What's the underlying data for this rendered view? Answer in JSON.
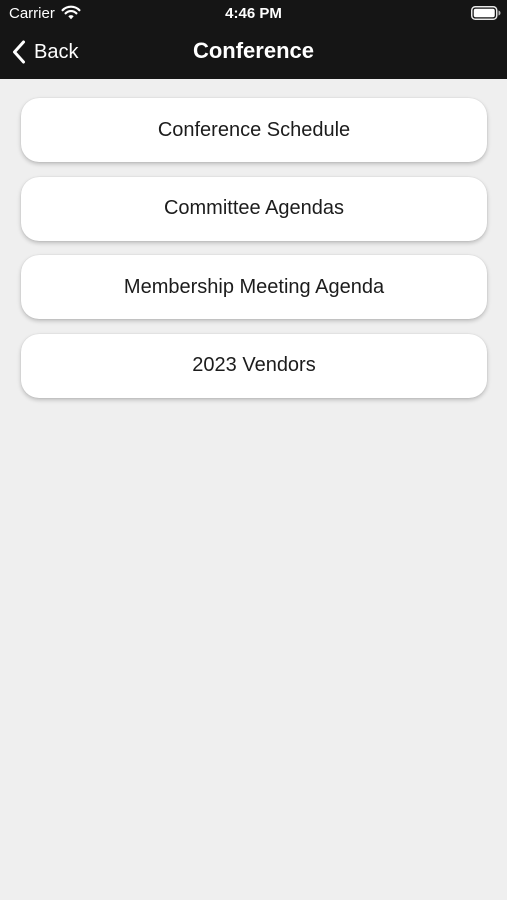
{
  "status_bar": {
    "carrier": "Carrier",
    "time": "4:46 PM",
    "wifi_icon": "wifi-icon",
    "battery_icon": "battery-icon"
  },
  "nav": {
    "back_label": "Back",
    "back_icon": "chevron-left-icon",
    "title": "Conference"
  },
  "menu": {
    "items": [
      {
        "label": "Conference Schedule"
      },
      {
        "label": "Committee Agendas"
      },
      {
        "label": "Membership Meeting Agenda"
      },
      {
        "label": "2023 Vendors"
      }
    ]
  },
  "colors": {
    "bar_background": "#151515",
    "page_background": "#efefef",
    "card_background": "#ffffff"
  }
}
